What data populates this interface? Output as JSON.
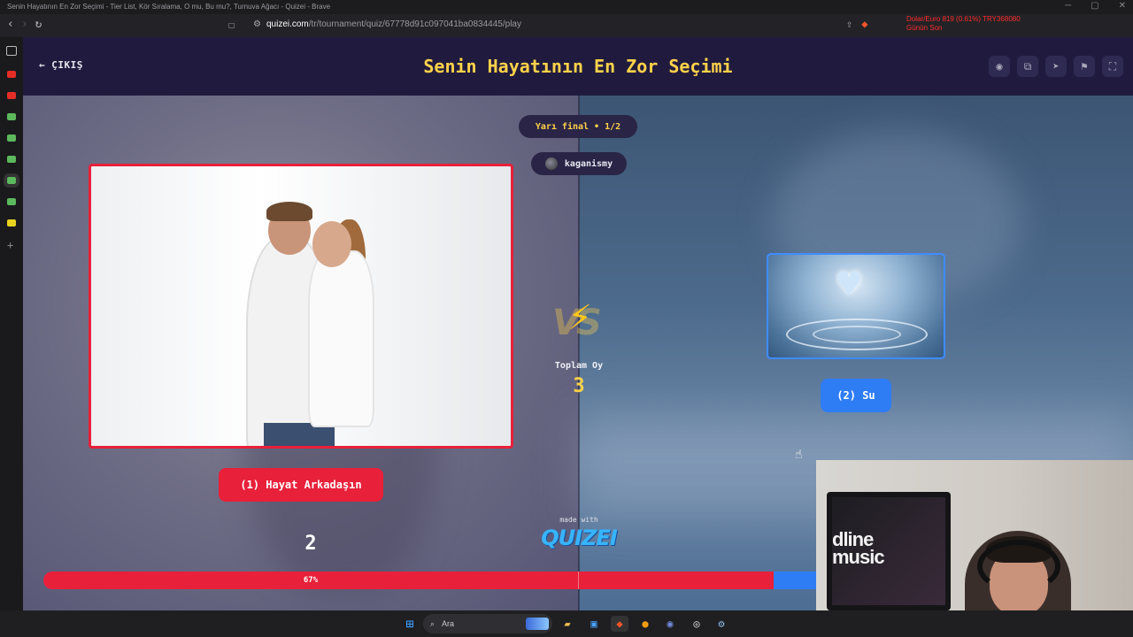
{
  "browser": {
    "window_title": "Senin Hayatının En Zor Seçimi - Tier List, Kör Sıralama, O mu, Bu mu?, Turnuva Ağacı - Quizei - Brave",
    "url_host": "quizei.com",
    "url_path": "/tr/tournament/quiz/67778d91c097041ba0834445/play",
    "ticker_line1": "Dolar/Euro  819 (0.61%)   TRY368080",
    "ticker_line2": "Günün Son"
  },
  "header": {
    "back_label": "ÇIKIŞ",
    "title": "Senin Hayatının En Zor Seçimi",
    "icons": [
      "eye-icon",
      "copy-link-icon",
      "send-icon",
      "flag-icon",
      "fullscreen-icon"
    ]
  },
  "match": {
    "round": "Yarı final • 1/2",
    "creator": "kaganismy",
    "total_label": "Toplam Oy",
    "total_votes": "3",
    "left": {
      "label": "(1) Hayat Arkadaşın",
      "votes": "2",
      "color": "#e8203a"
    },
    "right": {
      "label": "(2) Su",
      "color": "#2f7df5"
    },
    "progress": {
      "percent_label": "67%",
      "left_fraction": 0.67
    }
  },
  "branding": {
    "made_with": "made with",
    "brand": "QUIZEI"
  },
  "webcam": {
    "logo_line1": "dline",
    "logo_line2": "music"
  },
  "taskbar": {
    "search_placeholder": "Ara"
  },
  "colors": {
    "header_bg": "#201b3e",
    "title_yellow": "#ffd24a",
    "red": "#e8203a",
    "blue": "#2f7df5"
  }
}
